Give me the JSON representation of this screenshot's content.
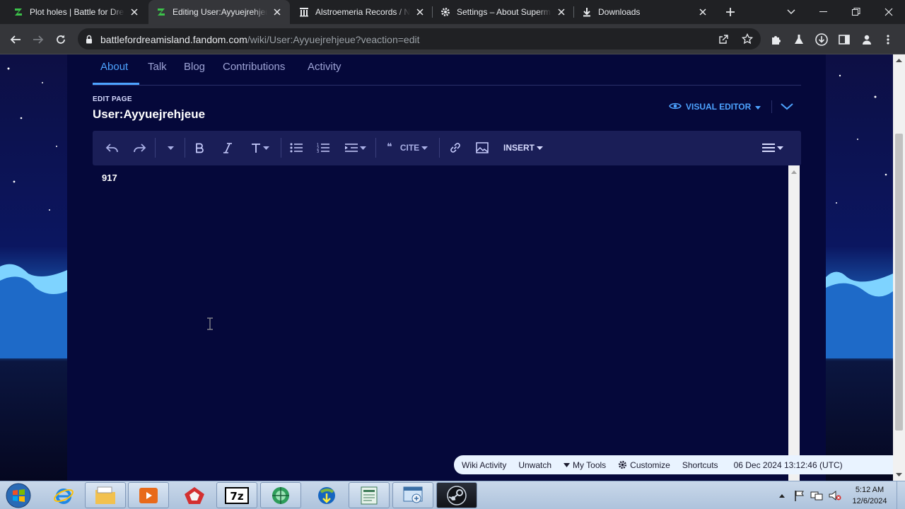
{
  "browser": {
    "tabs": [
      {
        "title": "Plot holes | Battle for Dream Island",
        "icon": "fandom-bfdi-favicon",
        "active": false
      },
      {
        "title": "Editing User:Ayyuejrehjeue",
        "icon": "fandom-bfdi-favicon",
        "active": true
      },
      {
        "title": "Alstroemeria Records / N",
        "icon": "columns-favicon",
        "active": false
      },
      {
        "title": "Settings – About Supermium",
        "icon": "gear-favicon",
        "active": false
      },
      {
        "title": "Downloads",
        "icon": "download-favicon",
        "active": false
      }
    ],
    "url_host": "battlefordreamisland.fandom.com",
    "url_path": "/wiki/User:Ayyuejrehjeue?veaction=edit"
  },
  "page": {
    "nav_tabs": [
      "About",
      "Talk",
      "Blog",
      "Contributions",
      "Activity"
    ],
    "active_nav": "About",
    "edit_label": "EDIT PAGE",
    "title": "User:Ayyuejrehjeue",
    "editor_mode": "VISUAL EDITOR",
    "toolbar": {
      "cite_label": "CITE",
      "insert_label": "INSERT"
    },
    "content_text": "917"
  },
  "wiki_toolbar": {
    "items": [
      "Wiki Activity",
      "Unwatch",
      "My Tools",
      "Customize",
      "Shortcuts"
    ],
    "timestamp": "06 Dec 2024 13:12:46 (UTC)"
  },
  "taskbar": {
    "apps": [
      "internet-explorer",
      "file-explorer",
      "media-player",
      "gitkraken",
      "7-zip",
      "network-app",
      "internet-download-manager",
      "notepad",
      "control-panel",
      "steam"
    ],
    "time": "5:12 AM",
    "date": "12/6/2024"
  },
  "colors": {
    "page_bg": "#05083a",
    "accent": "#4da3ff",
    "editor_toolbar": "#1a1e57"
  }
}
